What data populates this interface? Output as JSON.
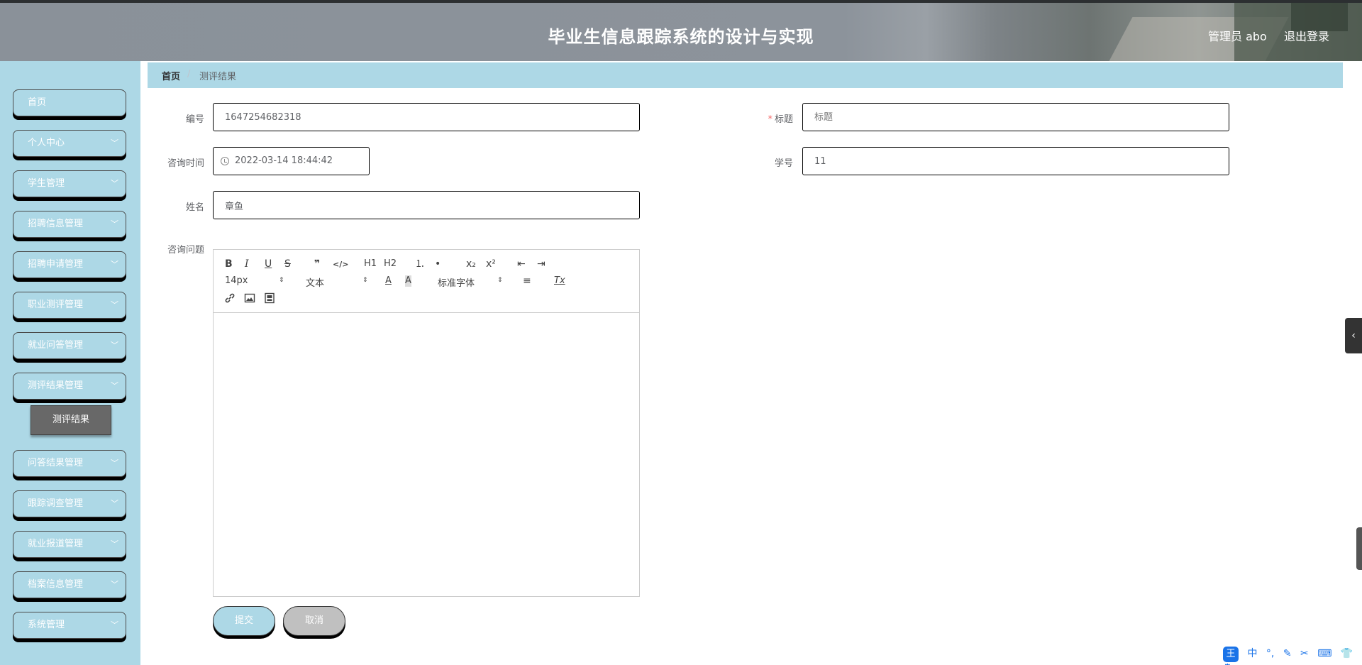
{
  "header": {
    "title": "毕业生信息跟踪系统的设计与实现",
    "user": "管理员 abo",
    "logout": "退出登录"
  },
  "sidebar": {
    "items": [
      {
        "label": "首页",
        "chevron": false
      },
      {
        "label": "个人中心",
        "chevron": true
      },
      {
        "label": "学生管理",
        "chevron": true
      },
      {
        "label": "招聘信息管理",
        "chevron": true
      },
      {
        "label": "招聘申请管理",
        "chevron": true
      },
      {
        "label": "职业测评管理",
        "chevron": true
      },
      {
        "label": "就业问答管理",
        "chevron": true
      },
      {
        "label": "测评结果管理",
        "chevron": true
      },
      {
        "label": "问答结果管理",
        "chevron": true
      },
      {
        "label": "跟踪调查管理",
        "chevron": true
      },
      {
        "label": "就业报道管理",
        "chevron": true
      },
      {
        "label": "档案信息管理",
        "chevron": true
      },
      {
        "label": "系统管理",
        "chevron": true
      }
    ],
    "sub_item": "测评结果"
  },
  "breadcrumb": {
    "home": "首页",
    "separator": "/",
    "current": "测评结果"
  },
  "form": {
    "bianhao_label": "编号",
    "bianhao_value": "1647254682318",
    "biaoti_label": "标题",
    "biaoti_required": "*",
    "biaoti_placeholder": "标题",
    "zixunshijian_label": "咨询时间",
    "zixunshijian_value": "2022-03-14 18:44:42",
    "xuehao_label": "学号",
    "xuehao_value": "11",
    "xingming_label": "姓名",
    "xingming_value": "章鱼",
    "zixunwenti_label": "咨询问题"
  },
  "editor": {
    "row1": [
      "B",
      "I",
      "U",
      "S",
      "❞",
      "</>",
      "H1",
      "H2",
      "⒈",
      "•",
      "x₂",
      "x²",
      "⇤",
      "⇥"
    ],
    "font_size": "14px",
    "header_select": "文本",
    "font_color": "A",
    "bg_color": "A",
    "font_family": "标准字体",
    "align": "≡",
    "clean": "Tx",
    "row3": [
      "link",
      "image",
      "video"
    ]
  },
  "buttons": {
    "submit": "提交",
    "cancel": "取消"
  },
  "colors": {
    "accent": "#add8e6",
    "submit_bg": "#add8e6",
    "cancel_bg": "#c0c0c0",
    "submenu_bg": "#686868"
  },
  "system_tray": {
    "ime": "王",
    "lang": "中"
  }
}
